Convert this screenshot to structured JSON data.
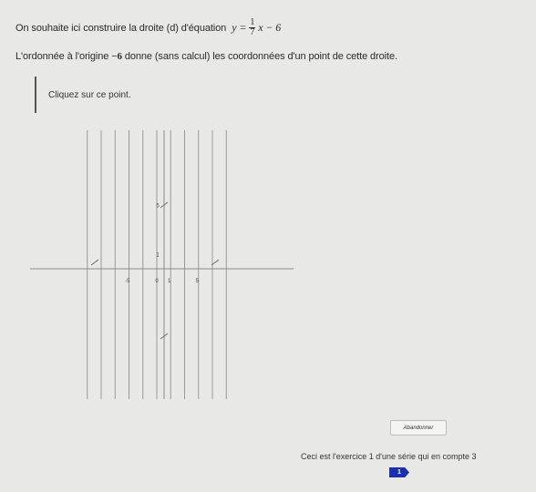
{
  "instruction": {
    "line1_text": "On souhaite ici construire la droite (d) d'équation",
    "equation": {
      "lhs": "y =",
      "frac_num": "1",
      "frac_den": "7",
      "rhs": "x − 6"
    },
    "line2_before": "L'ordonnée à l'origine",
    "line2_value": "−6",
    "line2_after": "donne (sans calcul) les coordonnées d'un point de cette droite."
  },
  "prompt": "Cliquez sur ce point.",
  "graph": {
    "x_range": [
      -10,
      10
    ],
    "y_range": [
      -10,
      10
    ],
    "grid": "vertical-lines",
    "x_tick_labels": [
      {
        "value": -5,
        "label": "-5"
      },
      {
        "value": 0,
        "label": "0"
      },
      {
        "value": 1,
        "label": "1"
      },
      {
        "value": 5,
        "label": "5"
      }
    ],
    "y_tick_labels": [
      {
        "value": 5,
        "label": "5"
      },
      {
        "value": 1,
        "label": "1"
      }
    ]
  },
  "buttons": {
    "abandon": "Abandonner"
  },
  "footer": {
    "note": "Ceci est l'exercice 1 d'une série qui en compte 3",
    "exercise_badge": "1"
  },
  "colors": {
    "badge": "#1a2fb0",
    "grid": "#9a9a9a"
  }
}
